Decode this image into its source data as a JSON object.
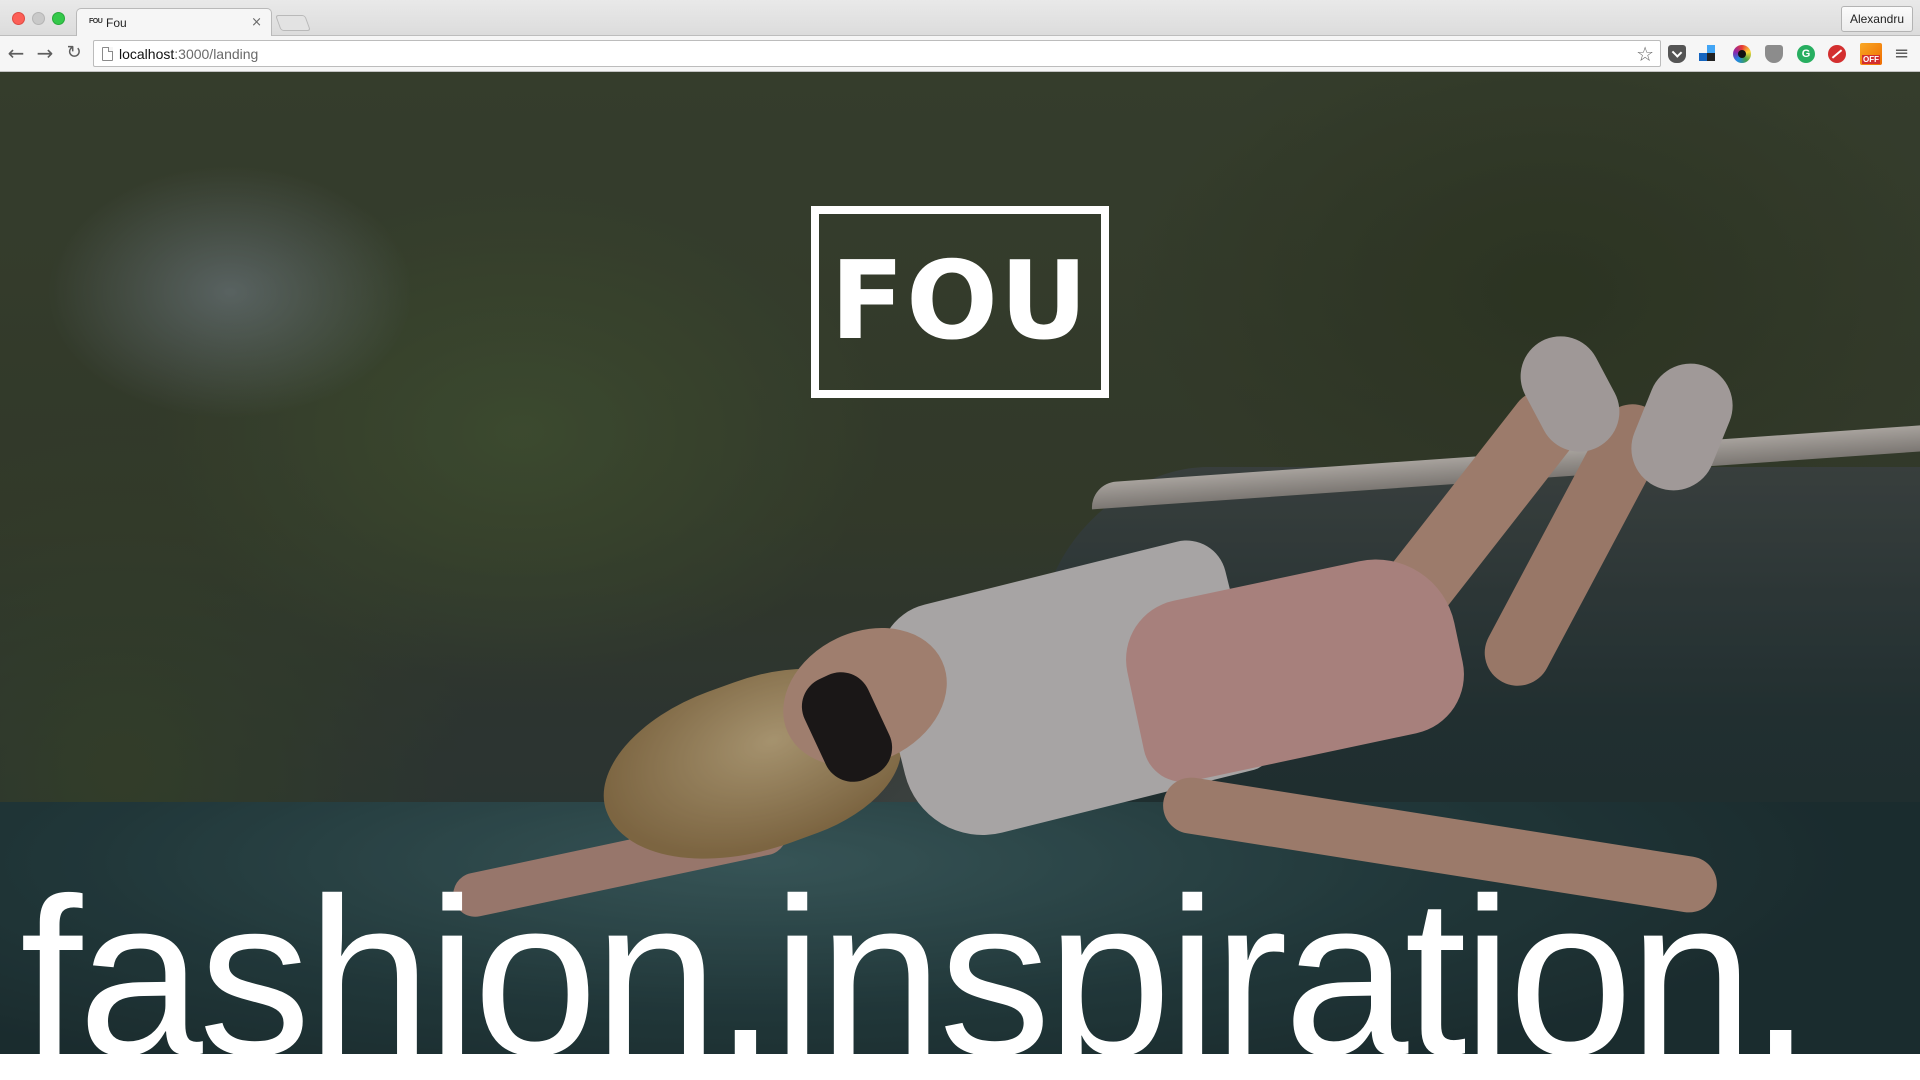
{
  "browser": {
    "tab_title": "Fou",
    "tab_favicon_text": "FOU",
    "tab_close": "×",
    "profile_name": "Alexandru",
    "url_host": "localhost",
    "url_path": ":3000/landing",
    "nav": {
      "back": "←",
      "forward": "→",
      "reload": "↻",
      "star": "☆",
      "menu": "≡"
    },
    "extensions": [
      {
        "name": "pocket-icon"
      },
      {
        "name": "buffer-icon"
      },
      {
        "name": "color-picker-icon"
      },
      {
        "name": "shield-icon"
      },
      {
        "name": "grammarly-icon",
        "label": "G"
      },
      {
        "name": "adblock-icon"
      },
      {
        "name": "honey-icon",
        "badge": "OFF"
      }
    ]
  },
  "page": {
    "logo": "FOU",
    "tagline": "fashion.inspiration."
  },
  "colors": {
    "logo": "#ffffff",
    "tagline": "#ffffff",
    "close_button": "#fc5f57",
    "maximize_button": "#34c84a"
  }
}
